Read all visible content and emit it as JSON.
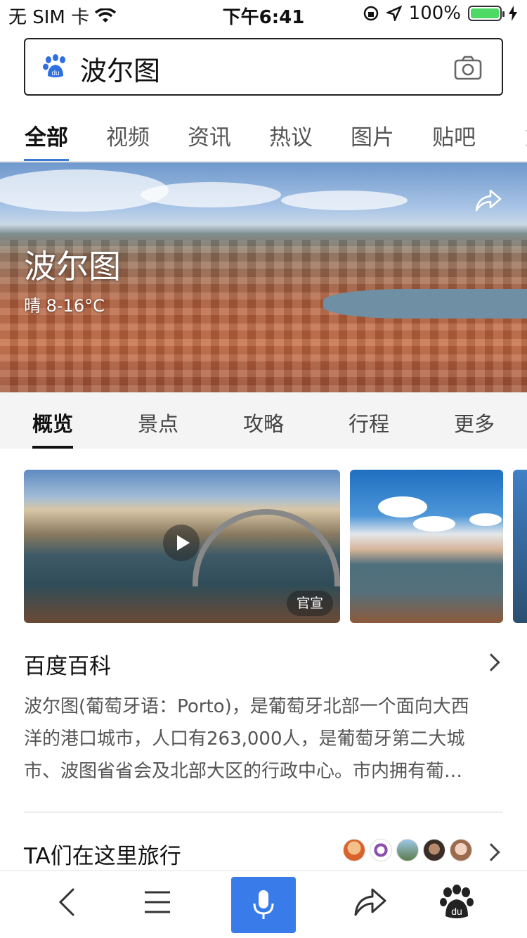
{
  "status_bar": {
    "carrier": "无 SIM 卡",
    "time": "下午6:41",
    "battery": "100%",
    "icons": [
      "wifi-icon",
      "orientation-lock-icon",
      "location-icon",
      "battery-icon",
      "charging-icon"
    ]
  },
  "search": {
    "query": "波尔图",
    "icons": [
      "baidu-paw-icon",
      "camera-icon"
    ]
  },
  "tabs": [
    "全部",
    "视频",
    "资讯",
    "热议",
    "图片",
    "贴吧",
    "文"
  ],
  "hero": {
    "city": "波尔图",
    "weather": "晴 8-16°C",
    "icon": "share-icon"
  },
  "sub_tabs": [
    "概览",
    "景点",
    "攻略",
    "行程",
    "更多"
  ],
  "media": {
    "badge": "官宣",
    "icons": [
      "play-icon"
    ]
  },
  "baike": {
    "title": "百度百科",
    "description_lines": [
      "波尔图(葡萄牙语：Porto)，是葡萄牙北部一个面向大西",
      "洋的港口城市，人口有263,000人，是葡萄牙第二大城",
      "市、波图省省会及北部大区的行政中心。市内拥有葡…"
    ]
  },
  "travel": {
    "title": "TA们在这里旅行"
  },
  "bottom_bar": {
    "icons": [
      "back-icon",
      "menu-icon",
      "microphone-icon",
      "share-icon",
      "baidu-paw-icon"
    ]
  },
  "colors": {
    "accent": "#3a7bea",
    "battery": "#4cd964"
  }
}
